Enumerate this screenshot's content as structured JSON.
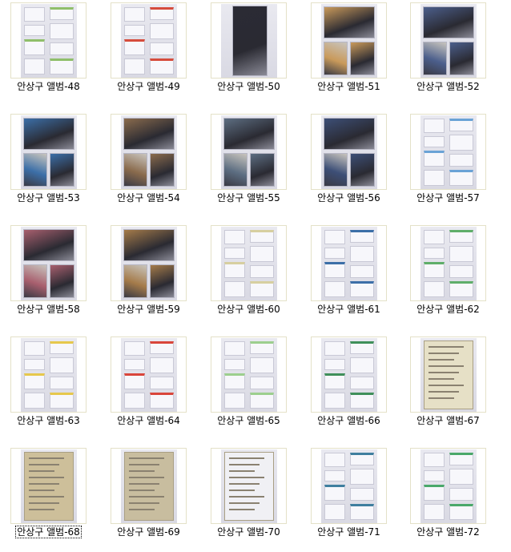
{
  "items": [
    {
      "label": "안상구 앨범-48",
      "kind": "docs",
      "accent": "#8fbf6a"
    },
    {
      "label": "안상구 앨범-49",
      "kind": "docs",
      "accent": "#d64c3c"
    },
    {
      "label": "안상구 앨범-50",
      "kind": "photo-rotated",
      "accent": "#2b2b35"
    },
    {
      "label": "안상구 앨범-51",
      "kind": "photos",
      "accent": "#c99a5b"
    },
    {
      "label": "안상구 앨범-52",
      "kind": "photos",
      "accent": "#4c5f8c"
    },
    {
      "label": "안상구 앨범-53",
      "kind": "photos",
      "accent": "#3c6fa8"
    },
    {
      "label": "안상구 앨범-54",
      "kind": "photos",
      "accent": "#8a6b4d"
    },
    {
      "label": "안상구 앨범-55",
      "kind": "photos",
      "accent": "#5d6e82"
    },
    {
      "label": "안상구 앨범-56",
      "kind": "photos",
      "accent": "#3d4f77"
    },
    {
      "label": "안상구 앨범-57",
      "kind": "docs",
      "accent": "#6aa3d6"
    },
    {
      "label": "안상구 앨범-58",
      "kind": "photos",
      "accent": "#a85f6e"
    },
    {
      "label": "안상구 앨범-59",
      "kind": "photos",
      "accent": "#a57b4a"
    },
    {
      "label": "안상구 앨범-60",
      "kind": "docs",
      "accent": "#d7cfa0"
    },
    {
      "label": "안상구 앨범-61",
      "kind": "docs",
      "accent": "#3c6fa8"
    },
    {
      "label": "안상구 앨범-62",
      "kind": "docs",
      "accent": "#5fae6a"
    },
    {
      "label": "안상구 앨범-63",
      "kind": "docs",
      "accent": "#e6c84c"
    },
    {
      "label": "안상구 앨범-64",
      "kind": "docs",
      "accent": "#d9453a"
    },
    {
      "label": "안상구 앨범-65",
      "kind": "docs",
      "accent": "#9ccf8e"
    },
    {
      "label": "안상구 앨범-66",
      "kind": "docs",
      "accent": "#3f8f5a"
    },
    {
      "label": "안상구 앨범-67",
      "kind": "paper",
      "accent": "#e6e0c6"
    },
    {
      "label": "안상구 앨범-68",
      "kind": "paper",
      "accent": "#cdbf9a",
      "selected": true
    },
    {
      "label": "안상구 앨범-69",
      "kind": "paper",
      "accent": "#c8bd9f"
    },
    {
      "label": "안상구 앨범-70",
      "kind": "paper",
      "accent": "#f0f0f4"
    },
    {
      "label": "안상구 앨범-71",
      "kind": "docs",
      "accent": "#3f7f9f"
    },
    {
      "label": "안상구 앨범-72",
      "kind": "docs",
      "accent": "#4aa86a"
    }
  ]
}
